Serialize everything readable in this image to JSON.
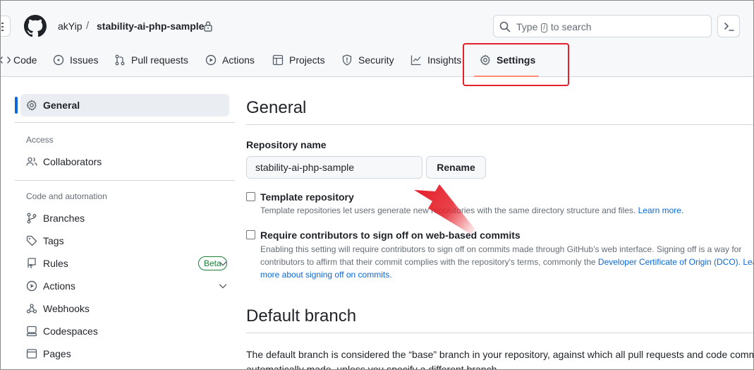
{
  "header": {
    "owner": "akYip",
    "separator": "/",
    "repo": "stability-ai-php-sample",
    "search": {
      "prefix": "Type",
      "key": "/",
      "suffix": "to search"
    }
  },
  "tabs": [
    {
      "label": "Code",
      "icon": "code-icon"
    },
    {
      "label": "Issues",
      "icon": "issue-icon"
    },
    {
      "label": "Pull requests",
      "icon": "pull-request-icon"
    },
    {
      "label": "Actions",
      "icon": "play-icon"
    },
    {
      "label": "Projects",
      "icon": "table-icon"
    },
    {
      "label": "Security",
      "icon": "shield-icon"
    },
    {
      "label": "Insights",
      "icon": "graph-icon"
    },
    {
      "label": "Settings",
      "icon": "gear-icon",
      "active": true
    }
  ],
  "sidebar": {
    "general": "General",
    "access_heading": "Access",
    "collaborators": "Collaborators",
    "code_heading": "Code and automation",
    "branches": "Branches",
    "tags": "Tags",
    "rules": "Rules",
    "rules_badge": "Beta",
    "actions": "Actions",
    "webhooks": "Webhooks",
    "codespaces": "Codespaces",
    "pages": "Pages"
  },
  "main": {
    "title": "General",
    "repo_name_label": "Repository name",
    "repo_name_value": "stability-ai-php-sample",
    "rename_label": "Rename",
    "template": {
      "label": "Template repository",
      "note": "Template repositories let users generate new repositories with the same directory structure and files.",
      "link": "Learn more.",
      "checked": false
    },
    "signoff": {
      "label": "Require contributors to sign off on web-based commits",
      "note1": "Enabling this setting will require contributors to sign off on commits made through GitHub’s web interface. Signing off is a way for",
      "note2a": "contributors to affirm that their commit complies with the repository's terms, commonly the",
      "note2_link": "Developer Certificate of Origin (DCO).",
      "note2_link_tail": "Learn",
      "note3_link": "more about signing off on commits.",
      "checked": false
    },
    "default_branch_title": "Default branch",
    "default_branch_text1": "The default branch is considered the “base” branch in your repository, against which all pull requests and code commits are",
    "default_branch_text2": "automatically made, unless you specify a different branch."
  },
  "colors": {
    "accent": "#0969da",
    "annotation": "#e5202a",
    "tab_underline": "#fd8c73",
    "beta": "#1a7f37"
  }
}
